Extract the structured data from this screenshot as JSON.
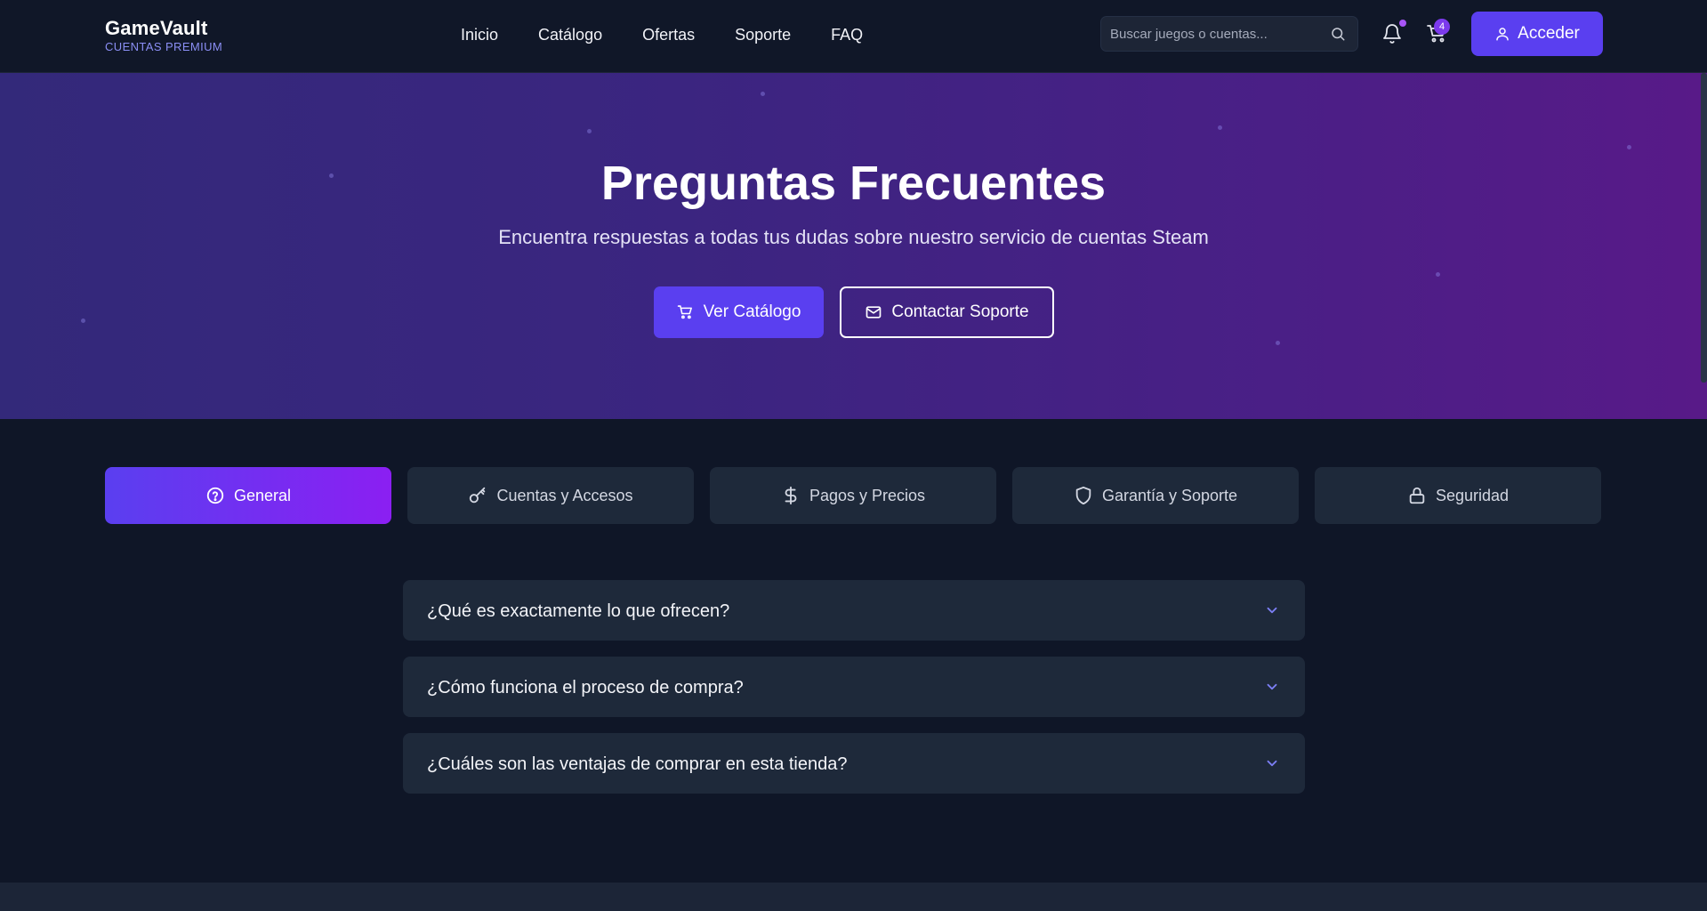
{
  "brand": {
    "name": "GameVault",
    "tagline": "CUENTAS PREMIUM"
  },
  "nav": {
    "items": [
      {
        "label": "Inicio"
      },
      {
        "label": "Catálogo"
      },
      {
        "label": "Ofertas"
      },
      {
        "label": "Soporte"
      },
      {
        "label": "FAQ"
      }
    ]
  },
  "search": {
    "placeholder": "Buscar juegos o cuentas...",
    "value": "",
    "icon": "search-icon"
  },
  "header": {
    "notifications_icon": "bell-icon",
    "cart_icon": "cart-icon",
    "cart_count": "4",
    "login_label": "Acceder",
    "login_icon": "user-icon"
  },
  "hero": {
    "title": "Preguntas Frecuentes",
    "subtitle": "Encuentra respuestas a todas tus dudas sobre nuestro servicio de cuentas Steam",
    "primary_button": "Ver Catálogo",
    "secondary_button": "Contactar Soporte"
  },
  "tabs": [
    {
      "label": "General",
      "icon": "question-circle-icon",
      "active": true
    },
    {
      "label": "Cuentas y Accesos",
      "icon": "key-icon",
      "active": false
    },
    {
      "label": "Pagos y Precios",
      "icon": "dollar-icon",
      "active": false
    },
    {
      "label": "Garantía y Soporte",
      "icon": "shield-icon",
      "active": false
    },
    {
      "label": "Seguridad",
      "icon": "lock-icon",
      "active": false
    }
  ],
  "faq": [
    {
      "question": "¿Qué es exactamente lo que ofrecen?"
    },
    {
      "question": "¿Cómo funciona el proceso de compra?"
    },
    {
      "question": "¿Cuáles son las ventajas de comprar en esta tienda?"
    }
  ],
  "colors": {
    "background": "#0f1627",
    "accent": "#5a3ff0",
    "accent_end": "#8b1ff2",
    "card": "#1e293a",
    "chevron": "#7c7ff5"
  }
}
